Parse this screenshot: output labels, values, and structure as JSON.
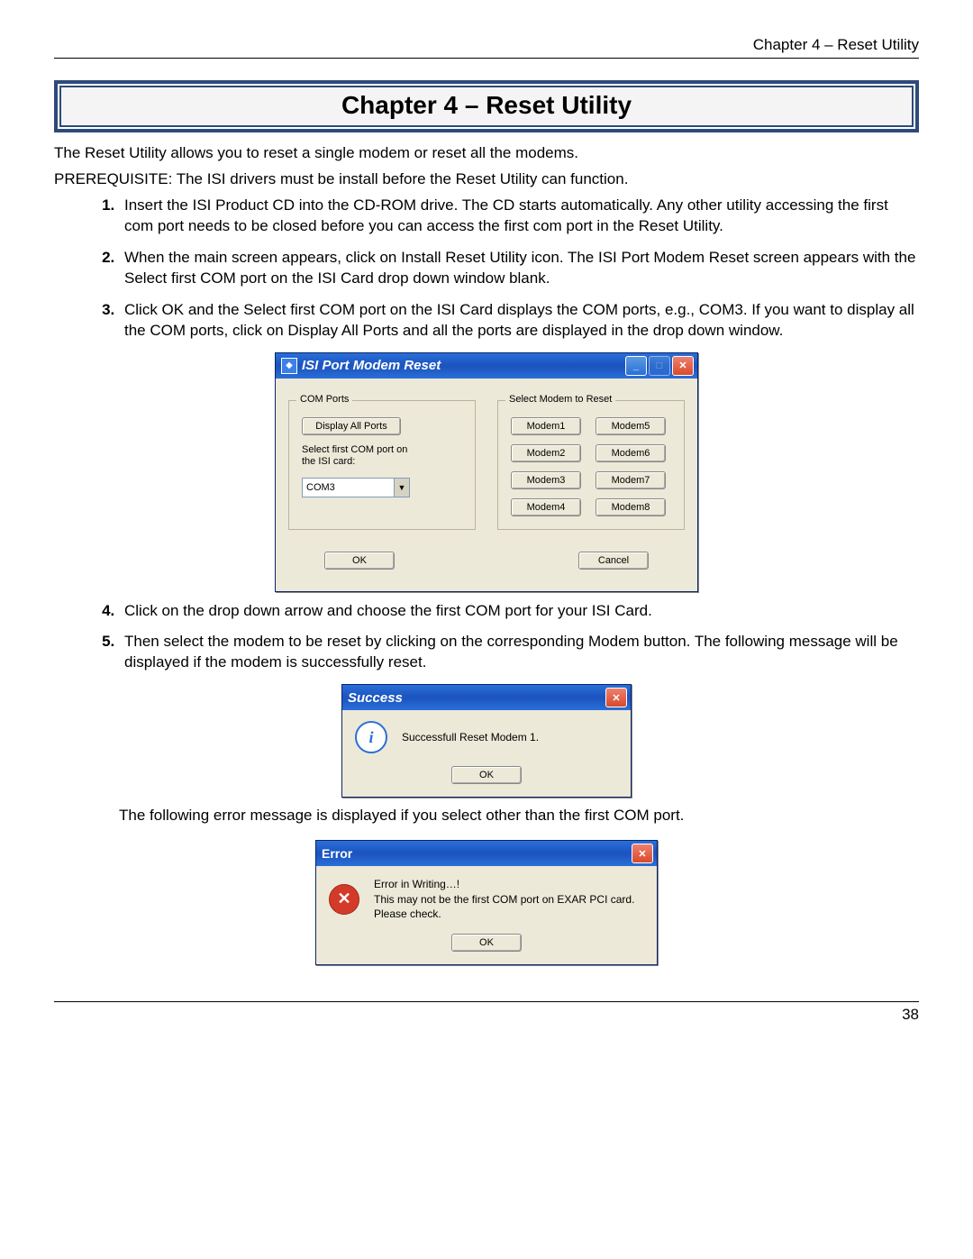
{
  "running_head": "Chapter 4 – Reset Utility",
  "chapter_title": "Chapter 4 – Reset Utility",
  "intro1": "The Reset Utility allows you to reset a single modem or reset all the modems.",
  "intro2": "PREREQUISITE:  The ISI drivers must be install before the Reset Utility can function.",
  "steps": [
    "Insert the ISI Product CD into the CD-ROM drive.  The CD starts automatically.  Any other utility accessing the first com port needs to be closed before you can access the first com port in the Reset Utility.",
    "When the main screen appears, click on Install Reset Utility icon. The ISI Port Modem Reset screen appears with the Select first COM port on the ISI Card drop down window blank.",
    "Click OK and the Select first COM port on the ISI Card displays the COM ports, e.g., COM3. If you want to display all the COM ports, click on Display All Ports and all the ports are displayed in the drop down window.",
    "Click on the drop down arrow and choose the first COM port for your ISI Card.",
    "Then select the modem to be reset by clicking on the corresponding Modem button. The following message will be displayed if the modem is successfully reset."
  ],
  "after_success_note": "The following error message is displayed if you select other than the first COM port.",
  "reset_dialog": {
    "title": "ISI Port Modem Reset",
    "group_comports": "COM Ports",
    "display_all": "Display All Ports",
    "select_label": "Select first COM port on the ISI card:",
    "selected_port": "COM3",
    "group_modems": "Select Modem to Reset",
    "modems": [
      "Modem1",
      "Modem2",
      "Modem3",
      "Modem4",
      "Modem5",
      "Modem6",
      "Modem7",
      "Modem8"
    ],
    "ok": "OK",
    "cancel": "Cancel"
  },
  "success_dialog": {
    "title": "Success",
    "message": "Successfull Reset Modem 1.",
    "ok": "OK"
  },
  "error_dialog": {
    "title": "Error",
    "line1": "Error in Writing…!",
    "line2": "This may not be the first COM port on EXAR PCI card.",
    "line3": "Please check.",
    "ok": "OK"
  },
  "page_number": "38"
}
